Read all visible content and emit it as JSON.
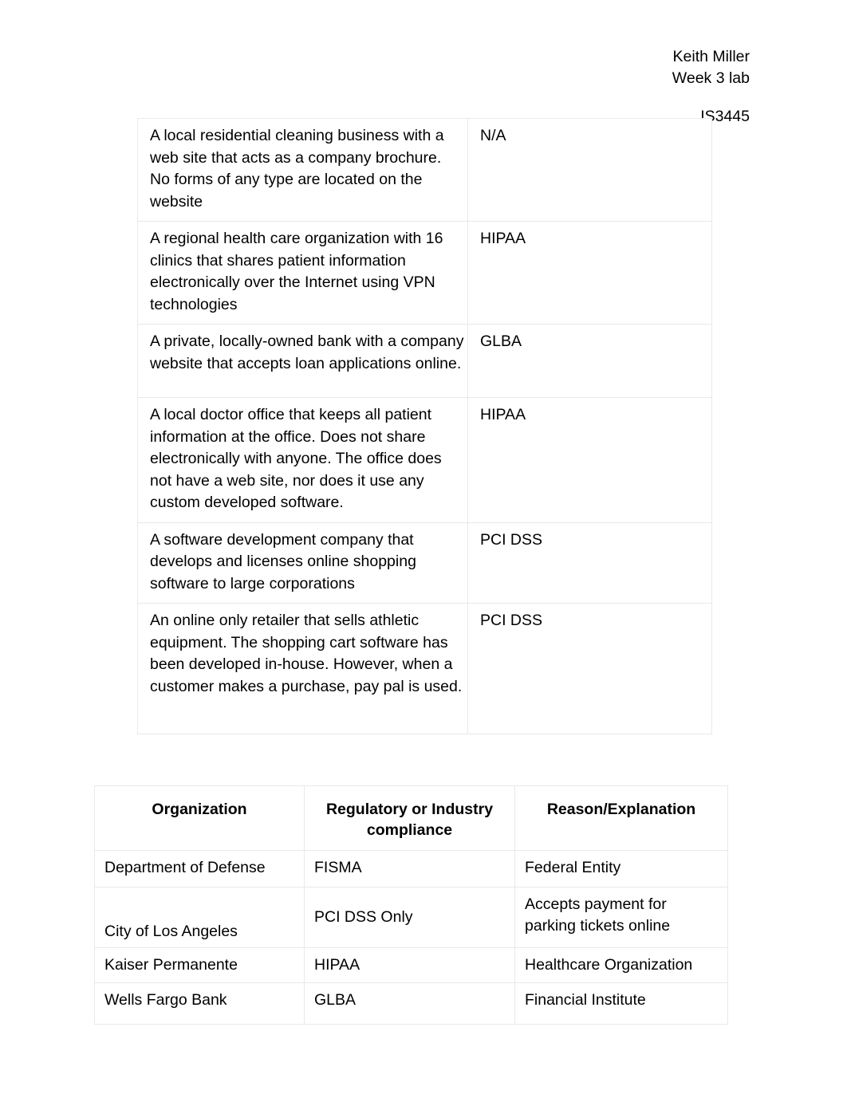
{
  "header": {
    "author": "Keith Miller",
    "assignment": "Week 3 lab",
    "course_code": "IS3445"
  },
  "scenario_table": {
    "rows": [
      {
        "scenario": "A local residential cleaning business with a web site that acts as a company brochure. No forms of any type are located on the website",
        "compliance": "N/A"
      },
      {
        "scenario": "A regional health care organization with 16 clinics that shares patient information electronically over the Internet using VPN technologies",
        "compliance": "HIPAA"
      },
      {
        "scenario": "A private, locally-owned bank with a company website that accepts loan applications online.",
        "compliance": "GLBA"
      },
      {
        "scenario": "A local doctor office that keeps all patient information at the office. Does not share electronically with anyone. The office does not have a web site, nor does it use any custom developed software.",
        "compliance": "HIPAA"
      },
      {
        "scenario": "A software development company that develops and licenses online shopping software to large corporations",
        "compliance": "PCI DSS"
      },
      {
        "scenario": "An online only retailer that sells athletic equipment. The shopping cart software has been developed in-house. However, when a customer makes a purchase, pay pal is used.",
        "compliance": "PCI DSS"
      }
    ]
  },
  "org_table": {
    "headers": {
      "organization": "Organization",
      "compliance": "Regulatory or Industry compliance",
      "reason": "Reason/Explanation"
    },
    "rows": [
      {
        "organization": "Department of Defense",
        "compliance": "FISMA",
        "reason": "Federal Entity"
      },
      {
        "organization": "City of Los Angeles",
        "compliance": "PCI DSS Only",
        "reason": "Accepts payment for parking tickets online"
      },
      {
        "organization": "Kaiser Permanente",
        "compliance": "HIPAA",
        "reason": "Healthcare Organization"
      },
      {
        "organization": "Wells Fargo Bank",
        "compliance": "GLBA",
        "reason": "Financial Institute"
      }
    ]
  }
}
